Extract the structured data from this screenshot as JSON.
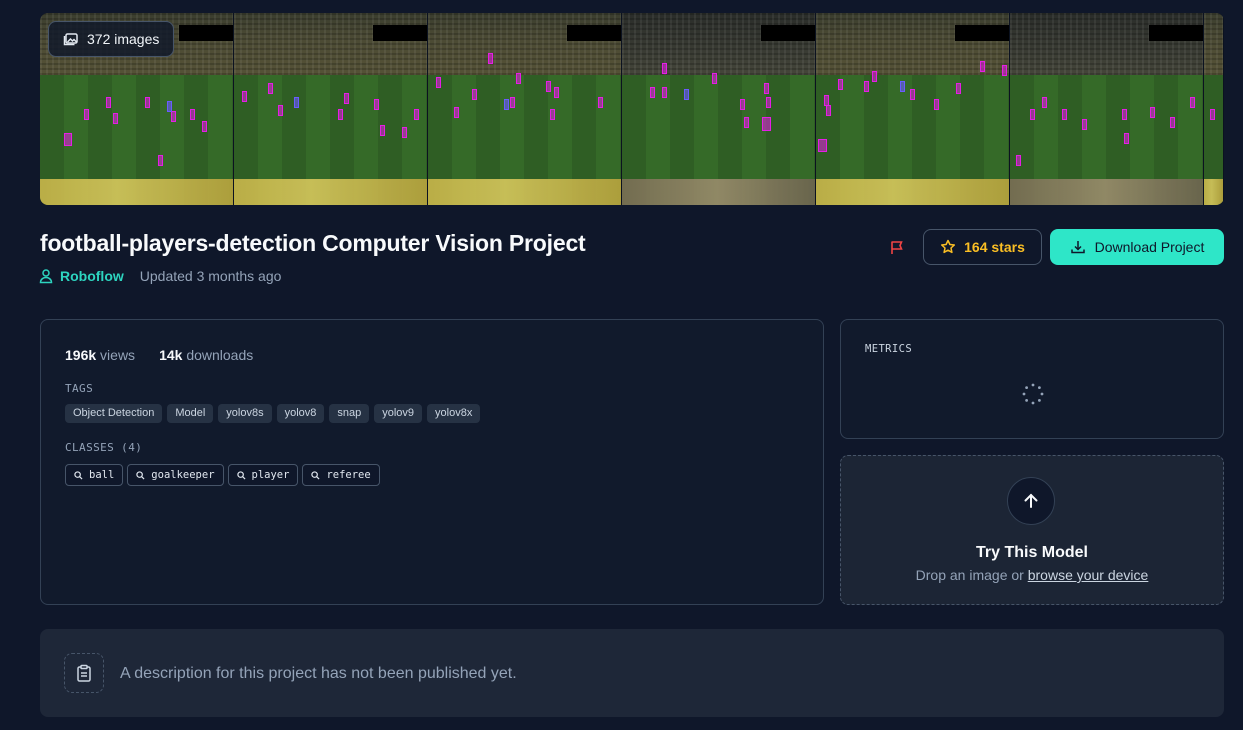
{
  "gallery": {
    "image_count_label": "372 images",
    "thumbnails": [
      "frame-1",
      "frame-2",
      "frame-3",
      "frame-4",
      "frame-5",
      "frame-6"
    ]
  },
  "project": {
    "title": "football-players-detection Computer Vision Project",
    "owner": "Roboflow",
    "updated": "Updated 3 months ago"
  },
  "actions": {
    "stars_label": "164 stars",
    "download_label": "Download Project"
  },
  "stats": {
    "views_value": "196k",
    "views_label": "views",
    "downloads_value": "14k",
    "downloads_label": "downloads"
  },
  "tags": {
    "heading": "TAGS",
    "items": [
      "Object Detection",
      "Model",
      "yolov8s",
      "yolov8",
      "snap",
      "yolov9",
      "yolov8x"
    ]
  },
  "classes": {
    "heading": "CLASSES (4)",
    "items": [
      "ball",
      "goalkeeper",
      "player",
      "referee"
    ]
  },
  "metrics": {
    "heading": "METRICS"
  },
  "try_model": {
    "title": "Try This Model",
    "subtitle_prefix": "Drop an image or",
    "subtitle_link": "browse your device"
  },
  "description": {
    "text": "A description for this project has not been published yet."
  },
  "colors": {
    "background": "#0f172a",
    "accent": "#2ee6c8",
    "owner_link": "#2dd4bf",
    "stars": "#fbbf24",
    "flag": "#ef4444",
    "annotation_box": "#e51ee5"
  }
}
